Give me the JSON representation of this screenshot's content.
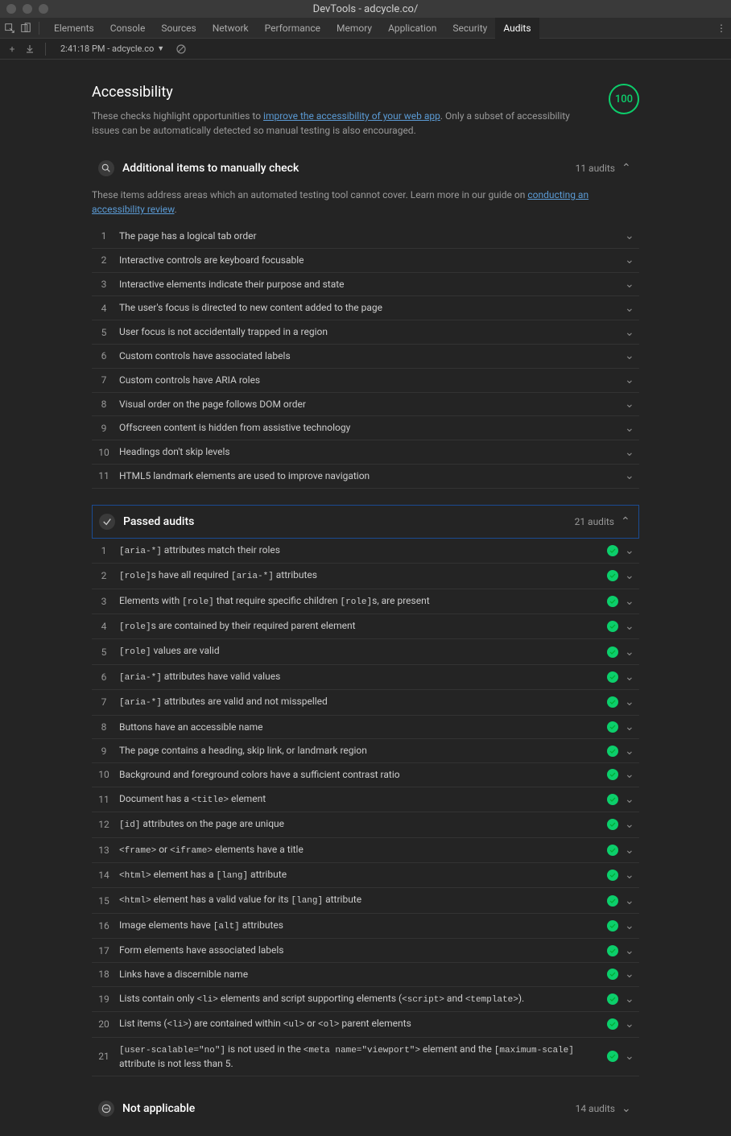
{
  "window": {
    "title": "DevTools - adcycle.co/"
  },
  "tabs": [
    "Elements",
    "Console",
    "Sources",
    "Network",
    "Performance",
    "Memory",
    "Application",
    "Security",
    "Audits"
  ],
  "activeTab": "Audits",
  "toolbar": {
    "label": "2:41:18 PM - adcycle.co"
  },
  "accessibility": {
    "title": "Accessibility",
    "desc_pre": "These checks highlight opportunities to ",
    "link": "improve the accessibility of your web app",
    "desc_post": ". Only a subset of accessibility issues can be automatically detected so manual testing is also encouraged.",
    "score": "100"
  },
  "manual": {
    "title": "Additional items to manually check",
    "count": "11 audits",
    "desc_pre": "These items address areas which an automated testing tool cannot cover. Learn more in our guide on ",
    "link": "conducting an accessibility review",
    "desc_post": ".",
    "items": [
      "The page has a logical tab order",
      "Interactive controls are keyboard focusable",
      "Interactive elements indicate their purpose and state",
      "The user's focus is directed to new content added to the page",
      "User focus is not accidentally trapped in a region",
      "Custom controls have associated labels",
      "Custom controls have ARIA roles",
      "Visual order on the page follows DOM order",
      "Offscreen content is hidden from assistive technology",
      "Headings don't skip levels",
      "HTML5 landmark elements are used to improve navigation"
    ]
  },
  "passed": {
    "title": "Passed audits",
    "count": "21 audits",
    "items": [
      "<code>[aria-*]</code> attributes match their roles",
      "<code>[role]</code>s have all required <code>[aria-*]</code> attributes",
      "Elements with <code>[role]</code> that require specific children <code>[role]</code>s, are present",
      "<code>[role]</code>s are contained by their required parent element",
      "<code>[role]</code> values are valid",
      "<code>[aria-*]</code> attributes have valid values",
      "<code>[aria-*]</code> attributes are valid and not misspelled",
      "Buttons have an accessible name",
      "The page contains a heading, skip link, or landmark region",
      "Background and foreground colors have a sufficient contrast ratio",
      "Document has a <code>&lt;title&gt;</code> element",
      "<code>[id]</code> attributes on the page are unique",
      "<code>&lt;frame&gt;</code> or <code>&lt;iframe&gt;</code> elements have a title",
      "<code>&lt;html&gt;</code> element has a <code>[lang]</code> attribute",
      "<code>&lt;html&gt;</code> element has a valid value for its <code>[lang]</code> attribute",
      "Image elements have <code>[alt]</code> attributes",
      "Form elements have associated labels",
      "Links have a discernible name",
      "Lists contain only <code>&lt;li&gt;</code> elements and script supporting elements (<code>&lt;script&gt;</code> and <code>&lt;template&gt;</code>).",
      "List items (<code>&lt;li&gt;</code>) are contained within <code>&lt;ul&gt;</code> or <code>&lt;ol&gt;</code> parent elements",
      "<code>[user-scalable=\"no\"]</code> is not used in the <code>&lt;meta name=\"viewport\"&gt;</code> element and the <code>[maximum-scale]</code> attribute is not less than 5."
    ]
  },
  "not_applicable": {
    "title": "Not applicable",
    "count": "14 audits"
  }
}
